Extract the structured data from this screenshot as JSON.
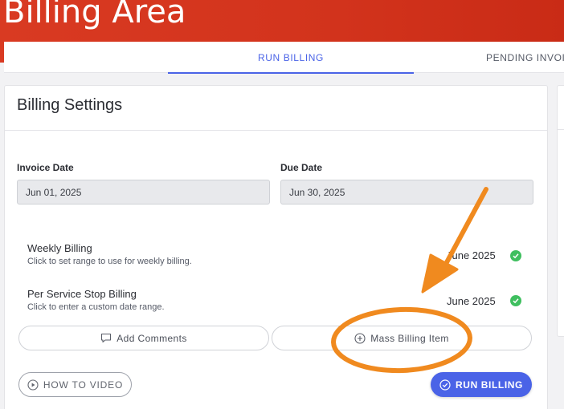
{
  "header": {
    "title": "Billing Area"
  },
  "tabs": [
    {
      "label": "RUN BILLING",
      "active": true
    },
    {
      "label": "PENDING INVOI"
    }
  ],
  "card": {
    "title": "Billing Settings",
    "invoice_date": {
      "label": "Invoice Date",
      "value": "Jun 01, 2025"
    },
    "due_date": {
      "label": "Due Date",
      "value": "Jun 30, 2025"
    },
    "billing_options": [
      {
        "name": "Weekly Billing",
        "description": "Click to set range to use for weekly billing.",
        "period": "June 2025",
        "status": "check"
      },
      {
        "name": "Per Service Stop Billing",
        "description": "Click to enter a custom date range.",
        "period": "June 2025",
        "status": "check"
      }
    ],
    "buttons": {
      "add_comments": "Add Comments",
      "mass_billing_item": "Mass Billing Item",
      "how_to_video": "HOW TO VIDEO",
      "run_billing": "RUN BILLING"
    }
  },
  "colors": {
    "header": "#d2331c",
    "accent": "#4a63e7",
    "check": "#3fbf5f",
    "annotation": "#f08a1f"
  },
  "icons": [
    "comment-icon",
    "plus-circle-icon",
    "play-circle-icon",
    "check-circle-icon",
    "check-icon"
  ]
}
